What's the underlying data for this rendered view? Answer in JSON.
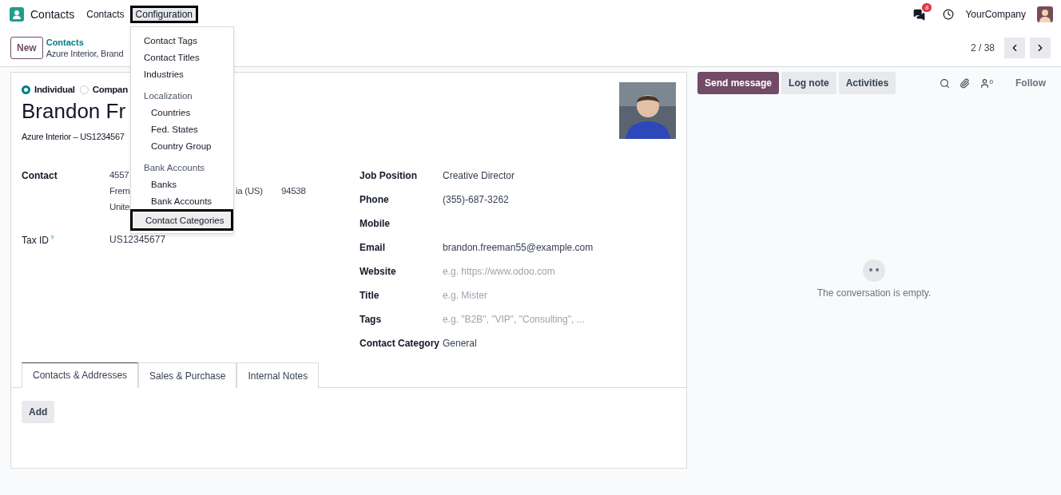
{
  "navbar": {
    "app_name": "Contacts",
    "menus": [
      {
        "label": "Contacts",
        "highlighted": false
      },
      {
        "label": "Configuration",
        "highlighted": true
      }
    ],
    "messages_badge": "8",
    "company": "YourCompany"
  },
  "control_panel": {
    "new_button": "New",
    "breadcrumb": "Contacts",
    "record_title": "Azure Interior, Brand",
    "pager": "2 / 38"
  },
  "config_menu": [
    {
      "kind": "item",
      "label": "Contact Tags",
      "highlighted": false
    },
    {
      "kind": "item",
      "label": "Contact Titles",
      "highlighted": false
    },
    {
      "kind": "item",
      "label": "Industries",
      "highlighted": false
    },
    {
      "kind": "header",
      "label": "Localization",
      "highlighted": false
    },
    {
      "kind": "subitem",
      "label": "Countries",
      "highlighted": false
    },
    {
      "kind": "subitem",
      "label": "Fed. States",
      "highlighted": false
    },
    {
      "kind": "subitem",
      "label": "Country Group",
      "highlighted": false
    },
    {
      "kind": "header",
      "label": "Bank Accounts",
      "highlighted": false
    },
    {
      "kind": "subitem",
      "label": "Banks",
      "highlighted": false
    },
    {
      "kind": "subitem",
      "label": "Bank Accounts",
      "highlighted": false
    },
    {
      "kind": "item",
      "label": "Contact Categories",
      "highlighted": true
    }
  ],
  "form": {
    "company_type": [
      {
        "label": "Individual",
        "selected": true
      },
      {
        "label": "Compan",
        "selected": false
      }
    ],
    "name": "Brandon Fr",
    "subtitle": "Azure Interior – US1234567",
    "contact_label": "Contact",
    "address": {
      "line_1": "4557",
      "line_2": [
        "Frem",
        "ia (US)",
        "94538"
      ],
      "line_3": "Unite"
    },
    "tax_id_label": "Tax ID",
    "tax_id_help": "?",
    "tax_id": "US12345677",
    "fields": [
      {
        "label": "Job Position",
        "value": "Creative Director"
      },
      {
        "label": "Phone",
        "value": "(355)-687-3262"
      },
      {
        "label": "Mobile"
      },
      {
        "label": "Email",
        "value": "brandon.freeman55@example.com"
      },
      {
        "label": "Website",
        "placeholder": "e.g. https://www.odoo.com"
      },
      {
        "label": "Title",
        "placeholder": "e.g. Mister"
      },
      {
        "label": "Tags",
        "placeholder": "e.g. \"B2B\", \"VIP\", \"Consulting\", ..."
      },
      {
        "label": "Contact Category",
        "value": "General"
      }
    ],
    "tabs": [
      {
        "label": "Contacts & Addresses",
        "selected": true
      },
      {
        "label": "Sales & Purchase",
        "selected": false
      },
      {
        "label": "Internal Notes",
        "selected": false
      }
    ],
    "add_button": "Add"
  },
  "chatter": {
    "buttons": [
      {
        "label": "Send message",
        "selected": true
      },
      {
        "label": "Log note",
        "selected": false
      },
      {
        "label": "Activities",
        "selected": false
      }
    ],
    "followers_count": "0",
    "follow": "Follow",
    "empty_text": "The conversation is empty."
  }
}
